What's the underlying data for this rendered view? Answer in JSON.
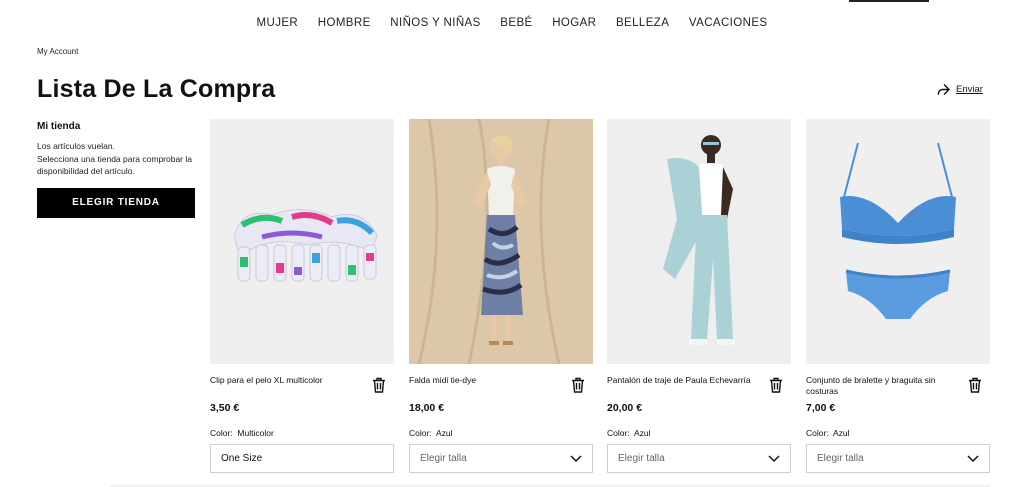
{
  "nav": [
    "MUJER",
    "HOMBRE",
    "NIÑOS Y NIÑAS",
    "BEBÉ",
    "HOGAR",
    "BELLEZA",
    "VACACIONES"
  ],
  "breadcrumb": "My Account",
  "title": "Lista De La Compra",
  "send_label": "Enviar",
  "store": {
    "heading": "Mi tienda",
    "line1": "Los artículos vuelan.",
    "line2": "Selecciona una tienda para comprobar la disponibilidad del artículo.",
    "button": "ELEGIR TIENDA"
  },
  "products": [
    {
      "name": "Clip para el pelo XL multicolor",
      "price": "3,50 €",
      "color_label": "Color:",
      "color": "Multicolor",
      "size": "One Size"
    },
    {
      "name": "Falda midi tie-dye",
      "price": "18,00 €",
      "color_label": "Color:",
      "color": "Azul",
      "size": "Elegir talla"
    },
    {
      "name": "Pantalón de traje de Paula Echevarría",
      "price": "20,00 €",
      "color_label": "Color:",
      "color": "Azul",
      "size": "Elegir talla"
    },
    {
      "name": "Conjunto de bralette y braguita sin costuras",
      "price": "7,00 €",
      "color_label": "Color:",
      "color": "Azul",
      "size": "Elegir talla"
    }
  ],
  "icons": {
    "send": "share-arrow-icon",
    "trash": "trash-icon",
    "chevron": "chevron-down-icon"
  }
}
